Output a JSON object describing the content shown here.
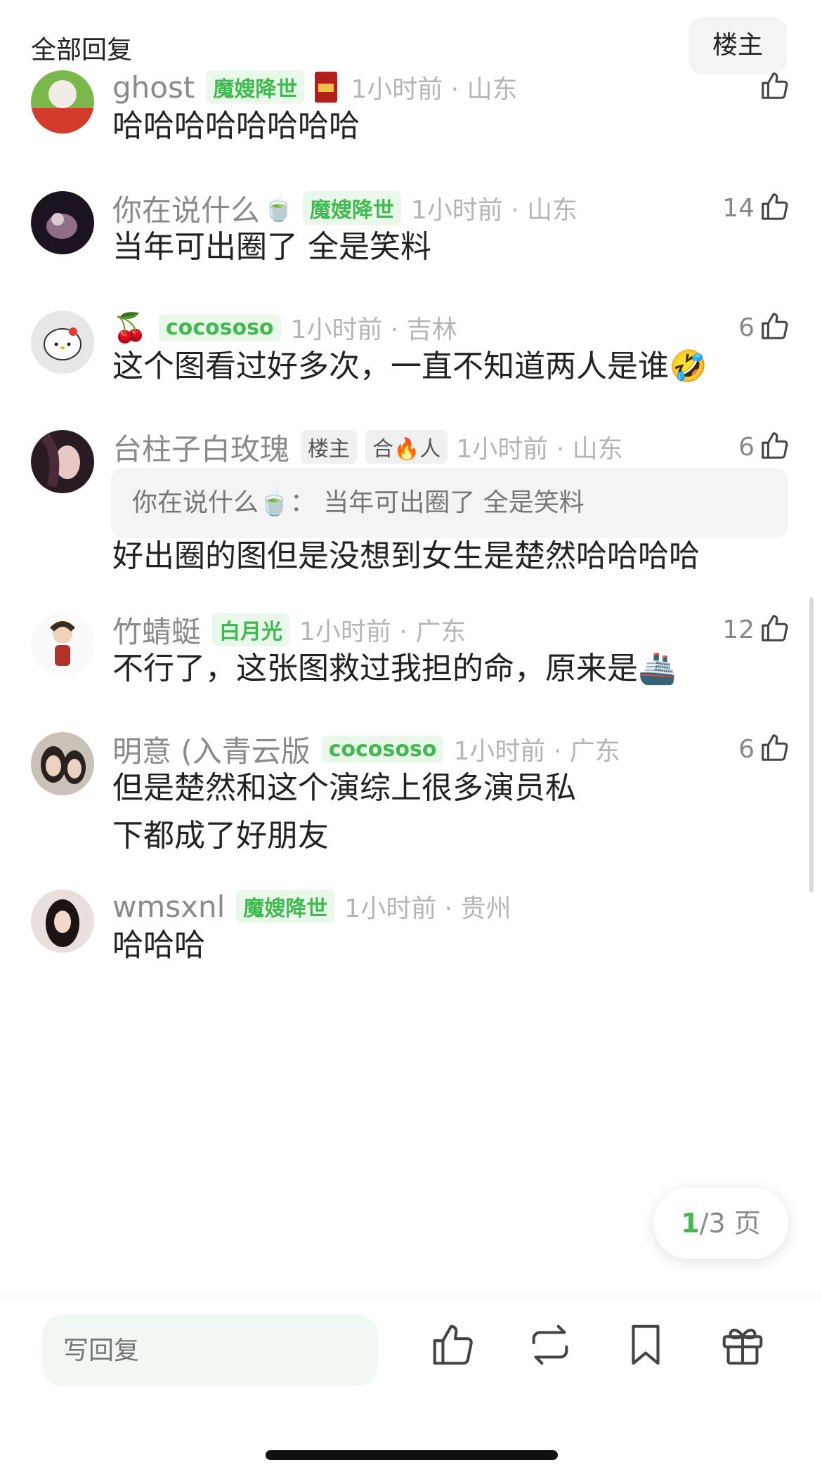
{
  "header": {
    "title": "全部回复",
    "owner_button": "楼主"
  },
  "comments": [
    {
      "name": "ghost",
      "badges": [
        "魔嫂降世"
      ],
      "time": "1小时前 · 山东",
      "likes": "",
      "text": "哈哈哈哈哈哈哈哈"
    },
    {
      "name": "你在说什么",
      "name_emoji": "🍵",
      "badges": [
        "魔嫂降世"
      ],
      "time": "1小时前 · 山东",
      "likes": "14",
      "text": "当年可出圈了 全是笑料"
    },
    {
      "name": "🍒",
      "badges": [
        "cocososo"
      ],
      "time": "1小时前 · 吉林",
      "likes": "6",
      "text": "这个图看过好多次，一直不知道两人是谁🤣"
    },
    {
      "name": "台柱子白玫瑰",
      "badges": [
        "楼主",
        "合🔥人"
      ],
      "time": "1小时前 · 山东",
      "likes": "6",
      "quote": "你在说什么🍵： 当年可出圈了 全是笑料",
      "text": "好出圈的图但是没想到女生是楚然哈哈哈哈"
    },
    {
      "name": "竹蜻蜓",
      "badges": [
        "白月光"
      ],
      "time": "1小时前 · 广东",
      "likes": "12",
      "text": "不行了，这张图救过我担的命，原来是🚢"
    },
    {
      "name": "明意 (入青云版",
      "badges": [
        "cocososo"
      ],
      "time": "1小时前 · 广东",
      "likes": "6",
      "text": "但是楚然和这个演综上很多演员私下都成了好朋友"
    },
    {
      "name": "wmsxnl",
      "badges": [
        "魔嫂降世"
      ],
      "time": "1小时前 · 贵州",
      "likes": "",
      "text": "哈哈哈"
    }
  ],
  "pager": {
    "current": "1",
    "total": "/3",
    "unit": " 页"
  },
  "bottom_bar": {
    "reply_placeholder": "写回复"
  },
  "colors": {
    "accent": "#3fb950",
    "badge_bg": "#eaf8ea",
    "meta_gray": "#8a8a8a"
  },
  "icons": [
    "thumbs-up-icon",
    "repost-icon",
    "bookmark-icon",
    "gift-icon",
    "red-packet-icon"
  ]
}
